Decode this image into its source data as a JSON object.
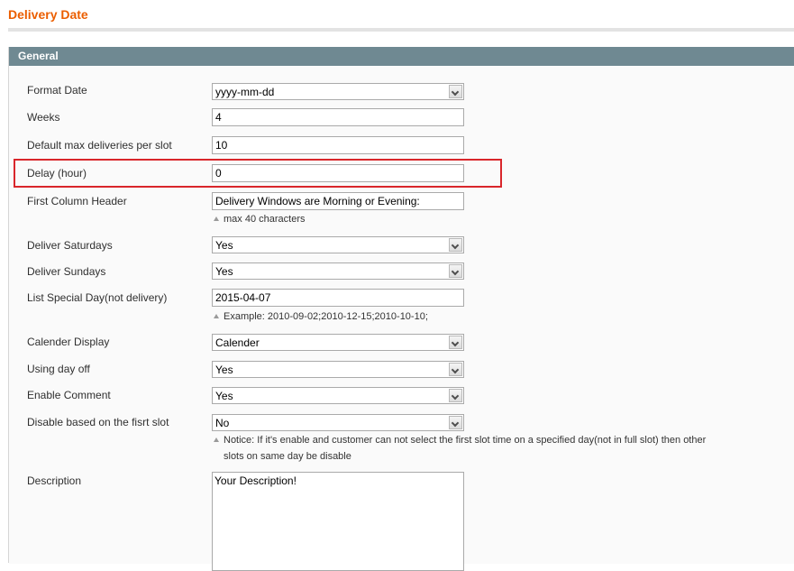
{
  "page": {
    "title": "Delivery Date"
  },
  "section": {
    "title": "General"
  },
  "fields": {
    "format_date": {
      "label": "Format Date",
      "value": "yyyy-mm-dd"
    },
    "weeks": {
      "label": "Weeks",
      "value": "4"
    },
    "max_deliveries": {
      "label": "Default max deliveries per slot",
      "value": "10"
    },
    "delay": {
      "label": "Delay (hour)",
      "value": "0"
    },
    "first_column_header": {
      "label": "First Column Header",
      "value": "Delivery Windows are Morning or Evening:",
      "note": "max 40 characters"
    },
    "deliver_saturdays": {
      "label": "Deliver Saturdays",
      "value": "Yes"
    },
    "deliver_sundays": {
      "label": "Deliver Sundays",
      "value": "Yes"
    },
    "special_day": {
      "label": "List Special Day(not delivery)",
      "value": "2015-04-07",
      "note": "Example: 2010-09-02;2010-12-15;2010-10-10;"
    },
    "calendar_display": {
      "label": "Calender Display",
      "value": "Calender"
    },
    "using_day_off": {
      "label": "Using day off",
      "value": "Yes"
    },
    "enable_comment": {
      "label": "Enable Comment",
      "value": "Yes"
    },
    "disable_first_slot": {
      "label": "Disable based on the fisrt slot",
      "value": "No",
      "note_line1": "Notice: If it's enable and customer can not select the first slot time on a specified day(not in full slot) then other",
      "note_line2": "slots on same day be disable"
    },
    "description": {
      "label": "Description",
      "value": "Your Description!"
    }
  },
  "colors": {
    "title": "#eb5e00",
    "section_header": "#6f8992",
    "highlight_border": "#d9262b"
  },
  "icons": {
    "select_arrow": "chevron-down-icon",
    "note_marker": "triangle-up-icon"
  }
}
